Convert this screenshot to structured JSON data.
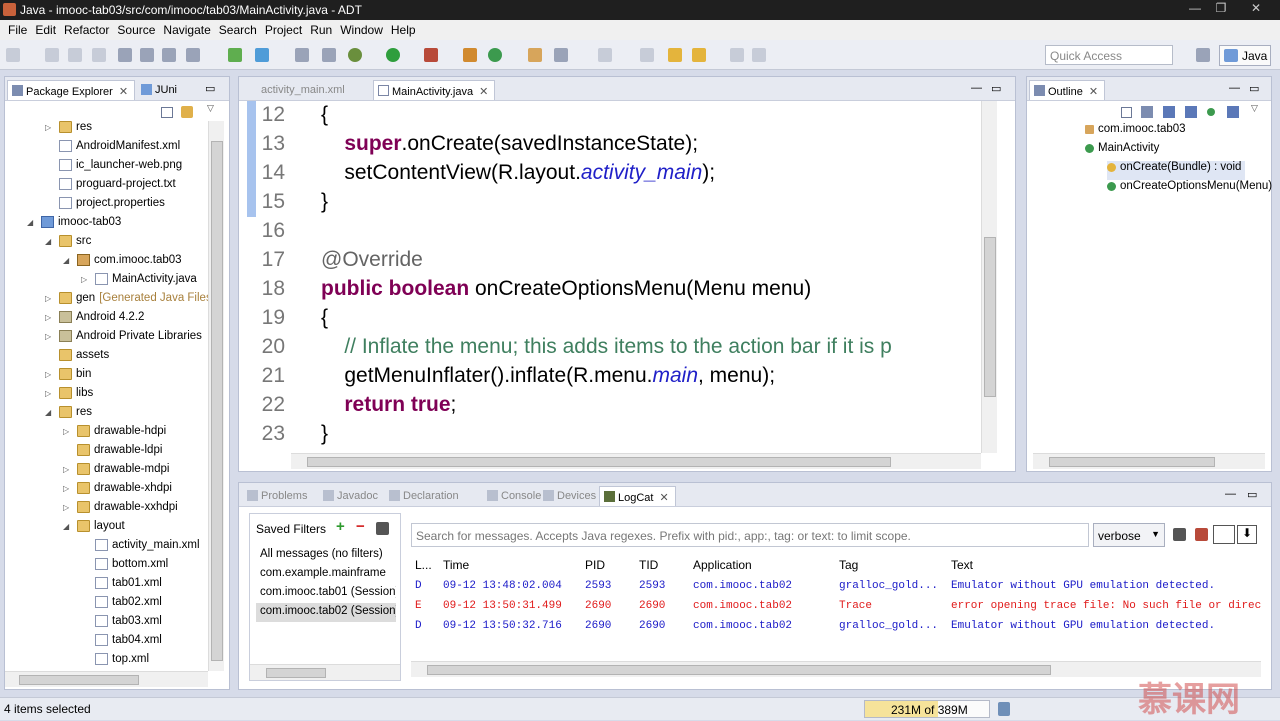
{
  "window": {
    "title": "Java - imooc-tab03/src/com/imooc/tab03/MainActivity.java - ADT"
  },
  "menu": [
    "File",
    "Edit",
    "Refactor",
    "Source",
    "Navigate",
    "Search",
    "Project",
    "Run",
    "Window",
    "Help"
  ],
  "toolbar": {
    "quick_access_placeholder": "Quick Access",
    "perspective": "Java"
  },
  "package_explorer": {
    "tabs": [
      "Package Explorer",
      "JUni"
    ],
    "tree": [
      {
        "label": "res",
        "depth": 1,
        "icon": "folder",
        "arrow": "▷"
      },
      {
        "label": "AndroidManifest.xml",
        "depth": 1,
        "icon": "xml",
        "arrow": ""
      },
      {
        "label": "ic_launcher-web.png",
        "depth": 1,
        "icon": "xml",
        "arrow": ""
      },
      {
        "label": "proguard-project.txt",
        "depth": 1,
        "icon": "xml",
        "arrow": ""
      },
      {
        "label": "project.properties",
        "depth": 1,
        "icon": "xml",
        "arrow": ""
      },
      {
        "label": "imooc-tab03",
        "depth": 0,
        "icon": "proj",
        "arrow": "◢"
      },
      {
        "label": "src",
        "depth": 1,
        "icon": "folder",
        "arrow": "◢"
      },
      {
        "label": "com.imooc.tab03",
        "depth": 2,
        "icon": "pkg",
        "arrow": "◢"
      },
      {
        "label": "MainActivity.java",
        "depth": 3,
        "icon": "xml",
        "arrow": "▷"
      },
      {
        "label": "gen",
        "depth": 1,
        "icon": "folder",
        "arrow": "▷",
        "suffix": "[Generated Java Files]"
      },
      {
        "label": "Android 4.2.2",
        "depth": 1,
        "icon": "lib",
        "arrow": "▷"
      },
      {
        "label": "Android Private Libraries",
        "depth": 1,
        "icon": "lib",
        "arrow": "▷"
      },
      {
        "label": "assets",
        "depth": 1,
        "icon": "folder",
        "arrow": ""
      },
      {
        "label": "bin",
        "depth": 1,
        "icon": "folder",
        "arrow": "▷"
      },
      {
        "label": "libs",
        "depth": 1,
        "icon": "folder",
        "arrow": "▷"
      },
      {
        "label": "res",
        "depth": 1,
        "icon": "folder",
        "arrow": "◢"
      },
      {
        "label": "drawable-hdpi",
        "depth": 2,
        "icon": "folder",
        "arrow": "▷"
      },
      {
        "label": "drawable-ldpi",
        "depth": 2,
        "icon": "folder",
        "arrow": ""
      },
      {
        "label": "drawable-mdpi",
        "depth": 2,
        "icon": "folder",
        "arrow": "▷"
      },
      {
        "label": "drawable-xhdpi",
        "depth": 2,
        "icon": "folder",
        "arrow": "▷"
      },
      {
        "label": "drawable-xxhdpi",
        "depth": 2,
        "icon": "folder",
        "arrow": "▷"
      },
      {
        "label": "layout",
        "depth": 2,
        "icon": "folder",
        "arrow": "◢"
      },
      {
        "label": "activity_main.xml",
        "depth": 3,
        "icon": "xml",
        "arrow": ""
      },
      {
        "label": "bottom.xml",
        "depth": 3,
        "icon": "xml",
        "arrow": ""
      },
      {
        "label": "tab01.xml",
        "depth": 3,
        "icon": "xml",
        "arrow": ""
      },
      {
        "label": "tab02.xml",
        "depth": 3,
        "icon": "xml",
        "arrow": ""
      },
      {
        "label": "tab03.xml",
        "depth": 3,
        "icon": "xml",
        "arrow": ""
      },
      {
        "label": "tab04.xml",
        "depth": 3,
        "icon": "xml",
        "arrow": ""
      },
      {
        "label": "top.xml",
        "depth": 3,
        "icon": "xml",
        "arrow": ""
      }
    ]
  },
  "editor": {
    "tabs": [
      "activity_main.xml",
      "MainActivity.java"
    ],
    "lines": [
      {
        "n": "12",
        "html": "{"
      },
      {
        "n": "13",
        "html": "    <span class=\"kw\">super</span>.onCreate(savedInstanceState);"
      },
      {
        "n": "14",
        "html": "    setContentView(R.layout.<span class=\"it\">activity_main</span>);"
      },
      {
        "n": "15",
        "html": "}"
      },
      {
        "n": "16",
        "html": ""
      },
      {
        "n": "17",
        "html": "<span class=\"an\">@Override</span>"
      },
      {
        "n": "18",
        "html": "<span class=\"kw\">public boolean</span> onCreateOptionsMenu(Menu menu)"
      },
      {
        "n": "19",
        "html": "{"
      },
      {
        "n": "20",
        "html": "    <span class=\"cm\">// Inflate the menu; this adds items to the action bar if it is p</span>"
      },
      {
        "n": "21",
        "html": "    getMenuInflater().inflate(R.menu.<span class=\"it\">main</span>, menu);"
      },
      {
        "n": "22",
        "html": "    <span class=\"kw\">return true</span>;"
      },
      {
        "n": "23",
        "html": "}"
      }
    ]
  },
  "outline": {
    "tab": "Outline",
    "items": [
      {
        "label": "com.imooc.tab03",
        "indent": 0
      },
      {
        "label": "MainActivity",
        "indent": 0
      },
      {
        "label": "onCreate(Bundle) : void",
        "indent": 1
      },
      {
        "label": "onCreateOptionsMenu(Menu)",
        "indent": 1
      }
    ]
  },
  "bottom": {
    "tabs": [
      "Problems",
      "Javadoc",
      "Declaration",
      "Console",
      "Devices",
      "LogCat"
    ],
    "saved_filters_title": "Saved Filters",
    "filters": [
      "All messages (no filters)",
      "com.example.mainframe",
      "com.imooc.tab01 (Session)",
      "com.imooc.tab02 (Session)"
    ],
    "search_placeholder": "Search for messages. Accepts Java regexes. Prefix with pid:, app:, tag: or text: to limit scope.",
    "level": "verbose",
    "columns": [
      "L...",
      "Time",
      "PID",
      "TID",
      "Application",
      "Tag",
      "Text"
    ],
    "rows": [
      {
        "level": "D",
        "time": "09-12 13:48:02.004",
        "pid": "2593",
        "tid": "2593",
        "app": "com.imooc.tab02",
        "tag": "gralloc_gold...",
        "text": "Emulator without GPU emulation detected.",
        "color": "#1a1ac8"
      },
      {
        "level": "E",
        "time": "09-12 13:50:31.499",
        "pid": "2690",
        "tid": "2690",
        "app": "com.imooc.tab02",
        "tag": "Trace",
        "text": "error opening trace file: No such file or direc",
        "color": "#e01a1a"
      },
      {
        "level": "D",
        "time": "09-12 13:50:32.716",
        "pid": "2690",
        "tid": "2690",
        "app": "com.imooc.tab02",
        "tag": "gralloc_gold...",
        "text": "Emulator without GPU emulation detected.",
        "color": "#1a1ac8"
      }
    ]
  },
  "status": {
    "selection": "4 items selected",
    "memory": "231M of 389M"
  },
  "watermark": "慕课网"
}
